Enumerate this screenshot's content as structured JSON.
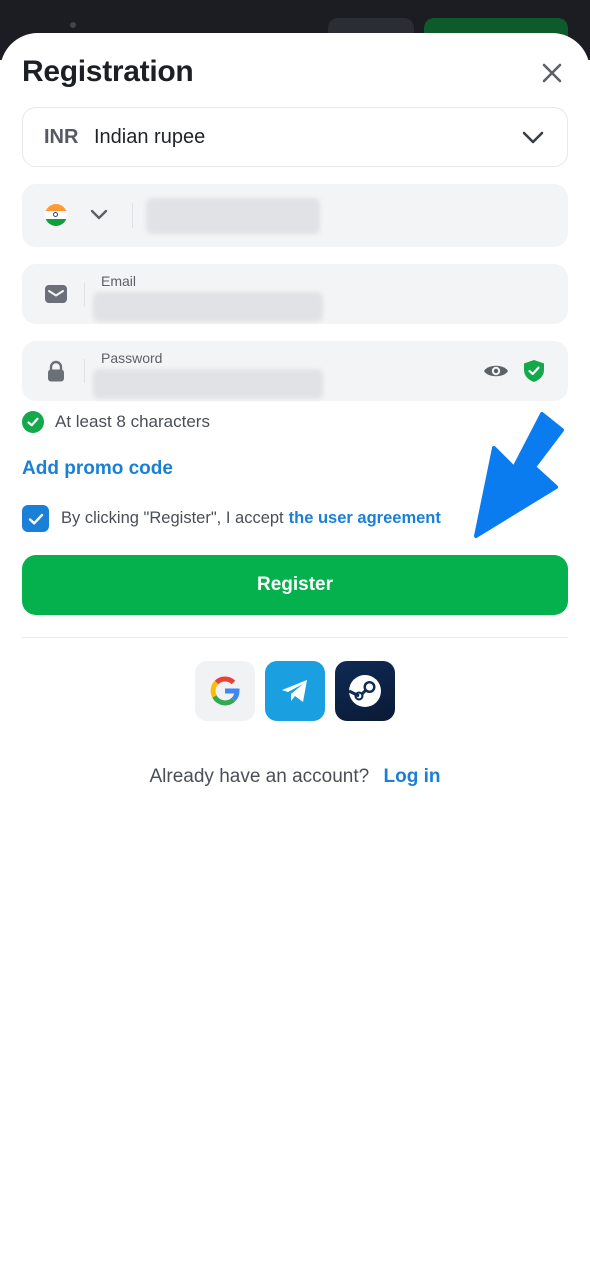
{
  "header": {
    "title": "Registration"
  },
  "currency": {
    "code": "INR",
    "name": "Indian rupee"
  },
  "email_field": {
    "label": "Email"
  },
  "password_field": {
    "label": "Password"
  },
  "password_hint": "At least 8 characters",
  "promo_link": "Add promo code",
  "agreement": {
    "text": "By clicking \"Register\", I accept",
    "link": "the user agreement",
    "checked": true
  },
  "register_button": "Register",
  "social": [
    "google-icon",
    "telegram-icon",
    "steam-icon"
  ],
  "login": {
    "question": "Already have an account?",
    "link": "Log in"
  },
  "colors": {
    "accent_green": "#04b14c",
    "link_blue": "#1a7fd6",
    "annotation_arrow": "#0a7cf0"
  }
}
